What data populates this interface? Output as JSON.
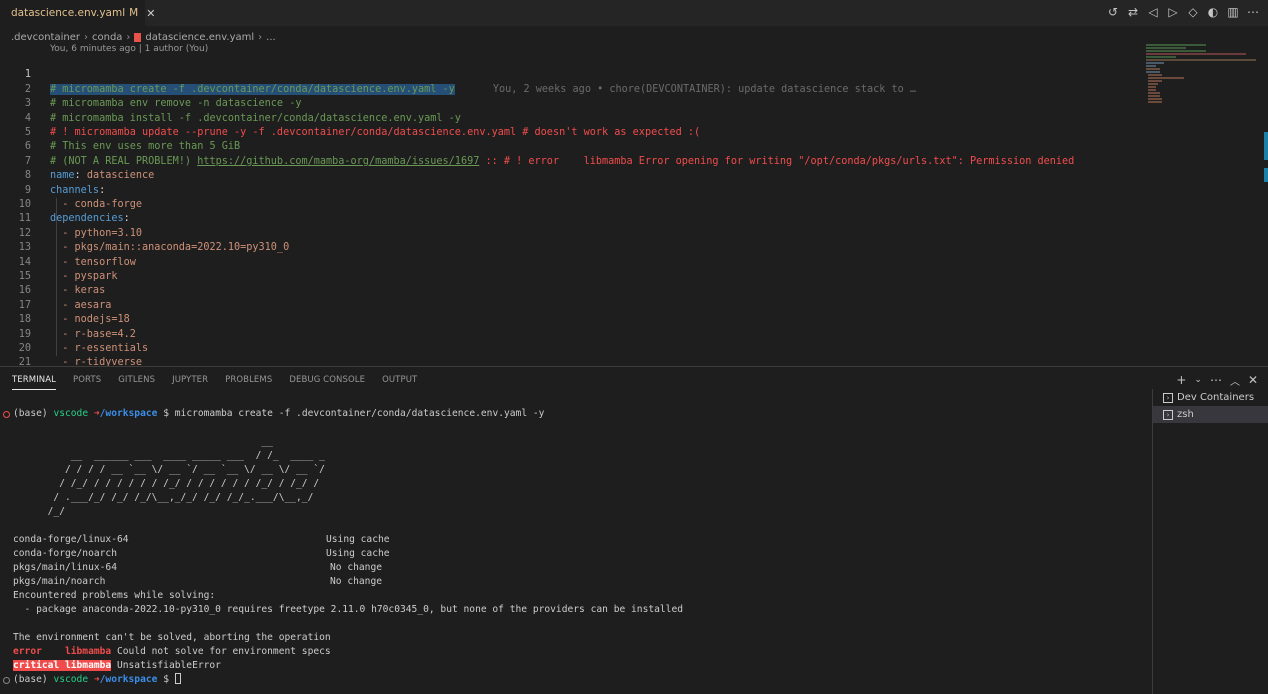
{
  "tab": {
    "filename": "datascience.env.yaml",
    "modified": "M"
  },
  "breadcrumb": {
    "items": [
      ".devcontainer",
      "conda",
      "datascience.env.yaml",
      "..."
    ]
  },
  "codelens": "You, 6 minutes ago | 1 author (You)",
  "blame": "You, 2 weeks ago • chore(DEVCONTAINER): update datascience stack to …",
  "editor_lines": [
    "# micromamba create -f .devcontainer/conda/datascience.env.yaml -y",
    "# micromamba env remove -n datascience -y",
    "# micromamba install -f .devcontainer/conda/datascience.env.yaml -y",
    "# ! micromamba update --prune -y -f .devcontainer/conda/datascience.env.yaml # doesn't work as expected :(",
    "# This env uses more than 5 GiB",
    "# (NOT A REAL PROBLEM!) ",
    "name: datascience",
    "channels:",
    "  - conda-forge",
    "dependencies:",
    "  - python=3.10",
    "  - pkgs/main::anaconda=2022.10=py310_0",
    "  - tensorflow",
    "  - pyspark",
    "  - keras",
    "  - aesara",
    "  - nodejs=18",
    "  - r-base=4.2",
    "  - r-essentials",
    "  - r-tidyverse",
    ""
  ],
  "line6": {
    "prefix": "# (NOT A REAL PROBLEM!) ",
    "link": "https://github.com/mamba-org/mamba/issues/1697",
    "suffix": " :: # ! error    libmamba Error opening for writing \"/opt/conda/pkgs/urls.txt\": Permission denied"
  },
  "panel_tabs": [
    "TERMINAL",
    "PORTS",
    "GITLENS",
    "JUPYTER",
    "PROBLEMS",
    "DEBUG CONSOLE",
    "OUTPUT"
  ],
  "terminal": {
    "prompt_env": "(base)",
    "prompt_user": "vscode",
    "prompt_arrow": "➜",
    "prompt_dir": "/workspace",
    "prompt_sym": "$",
    "command": "micromamba create -f .devcontainer/conda/datascience.env.yaml -y",
    "banner": [
      "                                           __",
      "          __  ______ ___  ____ _____ ___  / /_  ____ _",
      "         / / / / __ `__ \\/ __ `/ __ `__ \\/ __ \\/ __ `/",
      "        / /_/ / / / / / / /_/ / / / / / / /_/ / /_/ /",
      "       / .___/_/ /_/ /_/\\__,_/_/ /_/ /_/_.___/\\__,_/",
      "      /_/"
    ],
    "channels": [
      {
        "name": "conda-forge/linux-64",
        "status": "Using cache"
      },
      {
        "name": "conda-forge/noarch",
        "status": "Using cache"
      },
      {
        "name": "pkgs/main/linux-64",
        "status": "No change"
      },
      {
        "name": "pkgs/main/noarch",
        "status": "No change"
      }
    ],
    "problems_header": "Encountered problems while solving:",
    "problem_line": "  - package anaconda-2022.10-py310_0 requires freetype 2.11.0 h70c0345_0, but none of the providers can be installed",
    "abort_line": "The environment can't be solved, aborting the operation",
    "error_label": "error    libmamba",
    "error_msg": " Could not solve for environment specs",
    "critical_label": "critical libmamba",
    "critical_msg": " UnsatisfiableError"
  },
  "terminal_list": [
    "Dev Containers",
    "zsh"
  ]
}
